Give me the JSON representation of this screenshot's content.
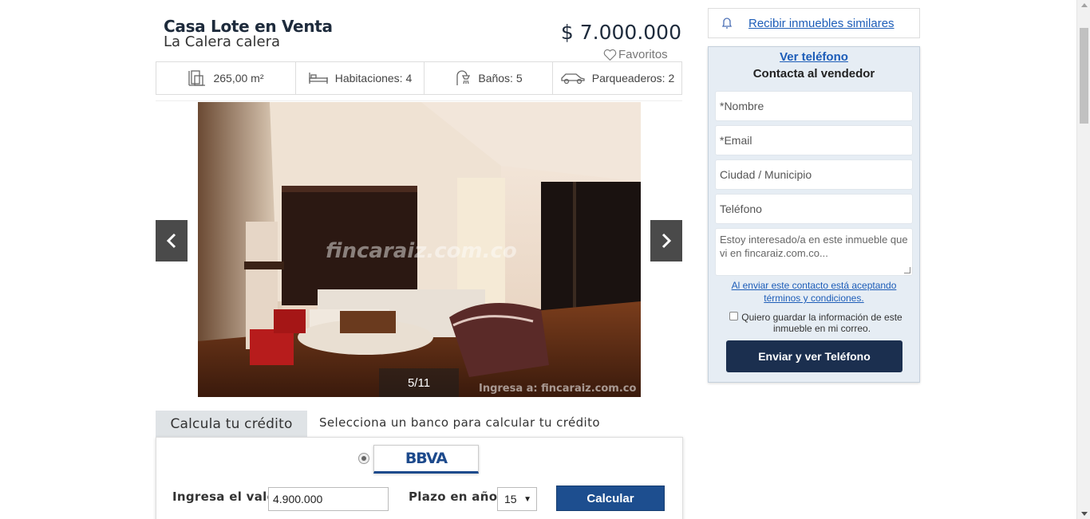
{
  "listing": {
    "title": "Casa Lote en Venta",
    "location": "La Calera calera",
    "price": "$ 7.000.000",
    "favorites_label": "Favoritos"
  },
  "features": [
    {
      "icon": "building-area-icon",
      "label": "265,00 m²"
    },
    {
      "icon": "bed-icon",
      "label": "Habitaciones: 4"
    },
    {
      "icon": "shower-icon",
      "label": "Baños: 5"
    },
    {
      "icon": "car-icon",
      "label": "Parqueaderos: 2"
    }
  ],
  "gallery": {
    "counter": "5/11",
    "watermark": "fincaraiz.com.co",
    "watermark_small": "Ingresa a: fincaraiz.com.co"
  },
  "credit": {
    "tab_label": "Calcula tu crédito",
    "note": "Selecciona un banco para calcular tu crédito",
    "bank": "BBVA",
    "value_label": "Ingresa el valor",
    "value": "4.900.000",
    "term_label": "Plazo en años",
    "term_value": "15",
    "calc_button": "Calcular"
  },
  "sidebar": {
    "similar_link": "Recibir inmuebles similares",
    "see_phone": "Ver teléfono",
    "contact_title": "Contacta al vendedor",
    "fields": {
      "name": "*Nombre",
      "email": "*Email",
      "city": "Ciudad / Municipio",
      "phone": "Teléfono",
      "message": "Estoy interesado/a en este inmueble que vi en fincaraiz.com.co..."
    },
    "terms": "Al enviar este contacto está aceptando términos y condiciones.",
    "save_info": "Quiero guardar la información de este inmueble en mi correo.",
    "send_button": "Enviar y ver Teléfono"
  },
  "colors": {
    "brand_dark": "#1b2f4f",
    "link": "#1d5db8",
    "bbva_blue": "#1d4a8c",
    "panel_bg": "#e6edf4"
  }
}
